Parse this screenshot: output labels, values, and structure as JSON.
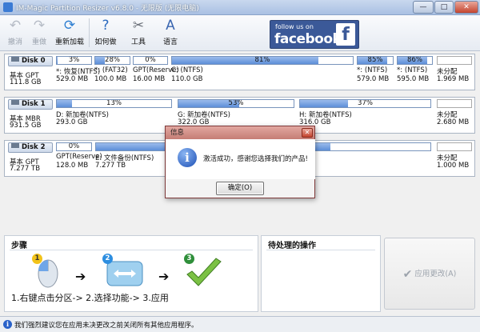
{
  "window": {
    "title": "IM-Magic Partition Resizer v6.8.0 - 无限版 (无限电脑)",
    "minimize": "—",
    "maximize": "□",
    "close": "✕"
  },
  "toolbar": {
    "undo": "撤消",
    "redo": "重做",
    "reload": "重新加载",
    "howto": "如何做",
    "tools": "工具",
    "language": "语言",
    "facebook_small": "follow us on",
    "facebook_big": "facebook",
    "facebook_f": "f"
  },
  "disks": [
    {
      "name": "Disk 0",
      "type": "基本 GPT",
      "size": "111.8 GB",
      "partitions": [
        {
          "percent": "3%",
          "used": 0.03,
          "name": "*: 恢复(NTFS)",
          "size": "529.0 MB"
        },
        {
          "percent": "28%",
          "used": 0.28,
          "name": "*: (FAT32)",
          "size": "100.0 MB"
        },
        {
          "percent": "0%",
          "used": 0.0,
          "name": "GPT(Reserve)",
          "size": "16.00 MB"
        },
        {
          "percent": "81%",
          "used": 0.81,
          "name": "C: (NTFS)",
          "size": "110.0 GB"
        },
        {
          "percent": "85%",
          "used": 0.85,
          "name": "*: (NTFS)",
          "size": "579.0 MB"
        },
        {
          "percent": "86%",
          "used": 0.86,
          "name": "*: (NTFS)",
          "size": "595.0 MB"
        },
        {
          "percent": "",
          "used": 0.0,
          "name": "未分配",
          "size": "1.969 MB"
        }
      ]
    },
    {
      "name": "Disk 1",
      "type": "基本 MBR",
      "size": "931.5 GB",
      "partitions": [
        {
          "percent": "13%",
          "used": 0.13,
          "name": "D: 新加卷(NTFS)",
          "size": "293.0 GB"
        },
        {
          "percent": "53%",
          "used": 0.53,
          "name": "G: 新加卷(NTFS)",
          "size": "322.0 GB"
        },
        {
          "percent": "37%",
          "used": 0.37,
          "name": "H: 新加卷(NTFS)",
          "size": "316.0 GB"
        },
        {
          "percent": "",
          "used": 0.0,
          "name": "未分配",
          "size": "2.680 MB"
        }
      ]
    },
    {
      "name": "Disk 2",
      "type": "基本 GPT",
      "size": "7.277 TB",
      "partitions": [
        {
          "percent": "0%",
          "used": 0.0,
          "name": "GPT(Reserve)",
          "size": "128.0 MB"
        },
        {
          "percent": "",
          "used": 0.7,
          "name": "E: 文件备份(NTFS)",
          "size": "7.277 TB"
        },
        {
          "percent": "",
          "used": 0.0,
          "name": "未分配",
          "size": "1.000 MB"
        }
      ]
    }
  ],
  "dialog": {
    "title": "信息",
    "close": "✕",
    "message": "激活成功，感谢您选择我们的产品!",
    "ok": "确定(O)"
  },
  "steps": {
    "title": "步骤",
    "caption": "1.右键点击分区-> 2.选择功能-> 3.应用",
    "n1": "1",
    "n2": "2",
    "n3": "3"
  },
  "pending": {
    "title": "待处理的操作"
  },
  "apply": {
    "label": "应用更改(A)"
  },
  "status": {
    "text": "我们强烈建议您在应用未决更改之前关闭所有其他应用程序。"
  }
}
